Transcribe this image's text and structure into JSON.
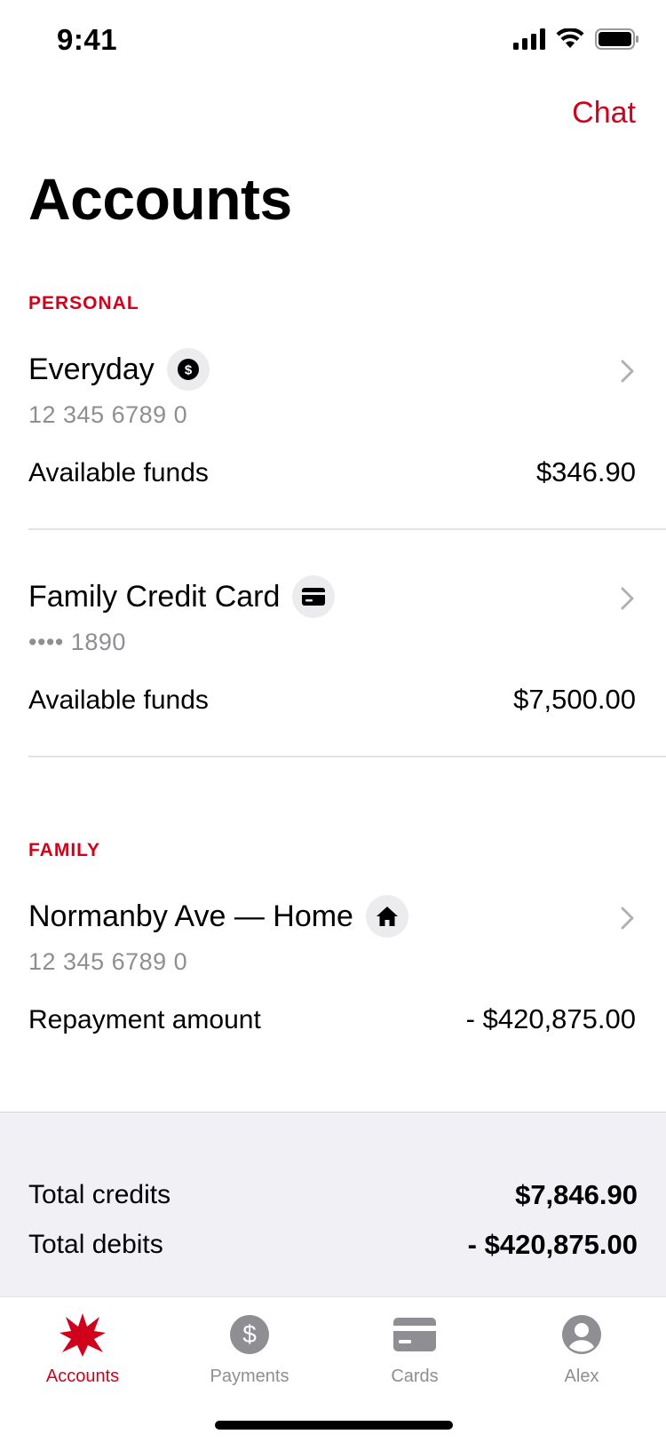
{
  "status": {
    "time": "9:41"
  },
  "header": {
    "chat_label": "Chat",
    "title": "Accounts"
  },
  "sections": {
    "personal": "PERSONAL",
    "family": "FAMILY"
  },
  "accounts": [
    {
      "name": "Everyday",
      "icon": "dollar-icon",
      "number": "12 345 6789 0",
      "label": "Available funds",
      "value": "$346.90"
    },
    {
      "name": "Family Credit Card",
      "icon": "credit-card-icon",
      "number": "•••• 1890",
      "label": "Available funds",
      "value": "$7,500.00"
    },
    {
      "name": "Normanby Ave — Home",
      "icon": "home-icon",
      "number": "12 345 6789 0",
      "label": "Repayment amount",
      "value": "- $420,875.00"
    }
  ],
  "totals": {
    "credits_label": "Total credits",
    "credits_value": "$7,846.90",
    "debits_label": "Total debits",
    "debits_value": "- $420,875.00"
  },
  "tabs": [
    {
      "label": "Accounts",
      "icon": "star-logo-icon",
      "active": true
    },
    {
      "label": "Payments",
      "icon": "dollar-icon",
      "active": false
    },
    {
      "label": "Cards",
      "icon": "card-icon",
      "active": false
    },
    {
      "label": "Alex",
      "icon": "profile-icon",
      "active": false
    }
  ],
  "colors": {
    "accent": "#d0021b",
    "muted": "#8e8e93",
    "panel": "#f1f1f5"
  }
}
